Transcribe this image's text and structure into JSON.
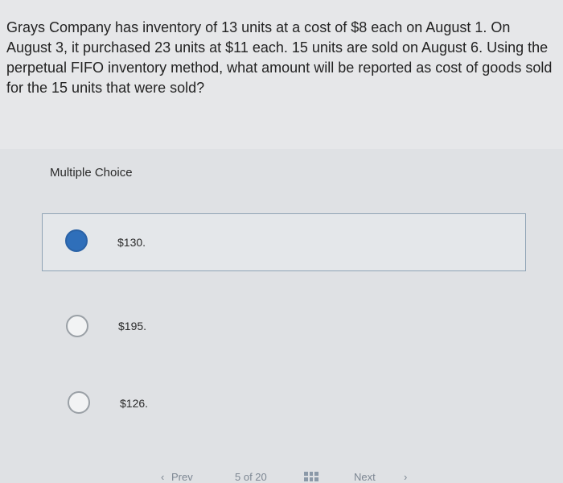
{
  "question": {
    "text": "Grays Company has inventory of 13 units at a cost of $8 each on August 1. On August 3, it purchased 23 units at $11 each. 15 units are sold on August 6. Using the perpetual FIFO inventory method, what amount will be reported as cost of goods sold for the 15 units that were sold?"
  },
  "answer": {
    "heading": "Multiple Choice",
    "options": [
      {
        "label": "$130.",
        "selected": true
      },
      {
        "label": "$195.",
        "selected": false
      },
      {
        "label": "$126.",
        "selected": false
      }
    ]
  },
  "navigation": {
    "prev_label": "Prev",
    "prev_icon": "chevron-left-icon",
    "position_label": "5 of 20",
    "grid_icon": "grid-icon",
    "next_label": "Next",
    "next_icon": "chevron-right-icon"
  },
  "colors": {
    "radio_selected": "#2f6fba",
    "accent_border": "#8fa3b5"
  }
}
